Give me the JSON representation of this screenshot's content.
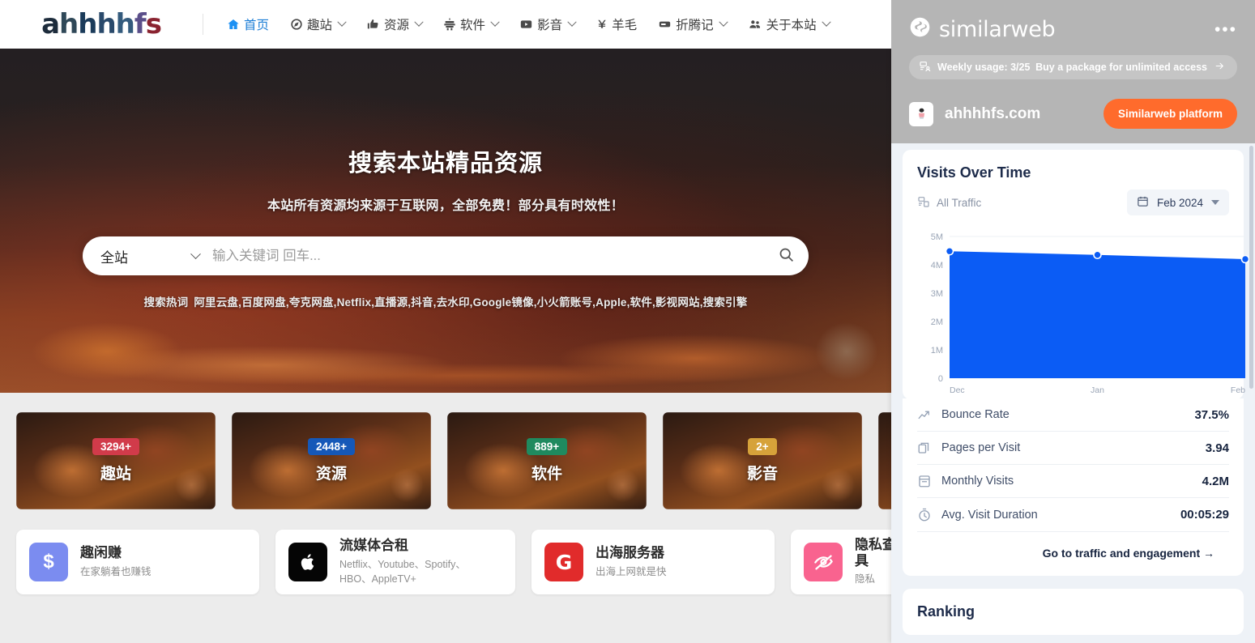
{
  "site": {
    "brand": "ahhhhfs",
    "nav": [
      {
        "label": "首页",
        "icon": "home-icon",
        "active": true,
        "caret": false
      },
      {
        "label": "趣站",
        "icon": "compass-icon",
        "active": false,
        "caret": true
      },
      {
        "label": "资源",
        "icon": "thumbs-up-icon",
        "active": false,
        "caret": true
      },
      {
        "label": "软件",
        "icon": "robot-icon",
        "active": false,
        "caret": true
      },
      {
        "label": "影音",
        "icon": "video-icon",
        "active": false,
        "caret": true
      },
      {
        "label": "羊毛",
        "icon": "yen-icon",
        "active": false,
        "caret": false
      },
      {
        "label": "折腾记",
        "icon": "card-icon",
        "active": false,
        "caret": true
      },
      {
        "label": "关于本站",
        "icon": "users-icon",
        "active": false,
        "caret": true
      }
    ]
  },
  "hero": {
    "title": "搜索本站精品资源",
    "subtitle": "本站所有资源均来源于互联网，全部免费！部分具有时效性！",
    "search": {
      "scope": "全站",
      "scope_icon": "chevron-down-icon",
      "placeholder": "输入关键词 回车...",
      "value": "",
      "button_icon": "search-icon"
    },
    "hotwords_label": "搜索热词",
    "hotwords": "阿里云盘,百度网盘,夸克网盘,Netflix,直播源,抖音,去水印,Google镜像,小火箭账号,Apple,软件,影视网站,搜索引擎"
  },
  "categories": [
    {
      "badge": "3294+",
      "badge_color": "#d13b4a",
      "name": "趣站"
    },
    {
      "badge": "2448+",
      "badge_color": "#1558b8",
      "name": "资源"
    },
    {
      "badge": "889+",
      "badge_color": "#1f8a5f",
      "name": "软件"
    },
    {
      "badge": "2+",
      "badge_color": "#d6a23a",
      "name": "影音"
    },
    {
      "badge": "",
      "badge_color": "#888888",
      "name": ""
    }
  ],
  "link_cards": [
    {
      "icon": "dollar-icon",
      "icon_bg": "#7b8cf0",
      "icon_glyph": "$",
      "title": "趣闲赚",
      "subtitle": "在家躺着也赚钱"
    },
    {
      "icon": "apple-icon",
      "icon_bg": "#050505",
      "icon_glyph": "",
      "title": "流媒体合租",
      "subtitle": "Netflix、Youtube、Spotify、HBO、AppleTV+"
    },
    {
      "icon": "google-icon",
      "icon_bg": "#e12b2b",
      "icon_glyph": "G",
      "title": "出海服务器",
      "subtitle": "出海上网就是快"
    },
    {
      "icon": "eye-off-icon",
      "icon_bg": "#f9638f",
      "icon_glyph": "",
      "title": "隐私查询工具",
      "subtitle": "隐私"
    }
  ],
  "similarweb": {
    "wordmark": "similarweb",
    "logo_icon": "similarweb-logo-icon",
    "more_icon": "more-options-icon",
    "usage": {
      "icon": "usage-icon",
      "text": "Weekly usage: 3/25",
      "cta": "Buy a package for unlimited access",
      "cta_icon": "arrow-right-icon"
    },
    "domain": "ahhhhfs.com",
    "favicon_icon": "site-favicon-icon",
    "platform_button": "Similarweb platform",
    "accent_color": "#ff6b2c",
    "visits_card": {
      "title": "Visits Over Time",
      "traffic_filter": "All Traffic",
      "traffic_icon": "traffic-filter-icon",
      "date_filter": "Feb 2024",
      "date_icon": "calendar-icon",
      "date_caret_icon": "chevron-down-icon"
    },
    "metrics": [
      {
        "icon": "bounce-rate-icon",
        "label": "Bounce Rate",
        "value": "37.5%"
      },
      {
        "icon": "pages-icon",
        "label": "Pages per Visit",
        "value": "3.94"
      },
      {
        "icon": "calendar-icon",
        "label": "Monthly Visits",
        "value": "4.2M"
      },
      {
        "icon": "clock-icon",
        "label": "Avg. Visit Duration",
        "value": "00:05:29"
      }
    ],
    "cta": "Go to traffic and engagement →",
    "ranking_title": "Ranking"
  },
  "chart_data": {
    "type": "area",
    "title": "Visits Over Time",
    "xlabel": "",
    "ylabel": "",
    "categories": [
      "Dec",
      "Jan",
      "Feb"
    ],
    "values": [
      4480000,
      4350000,
      4200000
    ],
    "ytick_labels": [
      "0",
      "1M",
      "2M",
      "3M",
      "4M",
      "5M"
    ],
    "ytick_values": [
      0,
      1000000,
      2000000,
      3000000,
      4000000,
      5000000
    ],
    "ylim": [
      0,
      5000000
    ],
    "series_color": "#0b5cf5",
    "marker_color": "#0b5cf5",
    "grid": true,
    "legend": "none"
  }
}
